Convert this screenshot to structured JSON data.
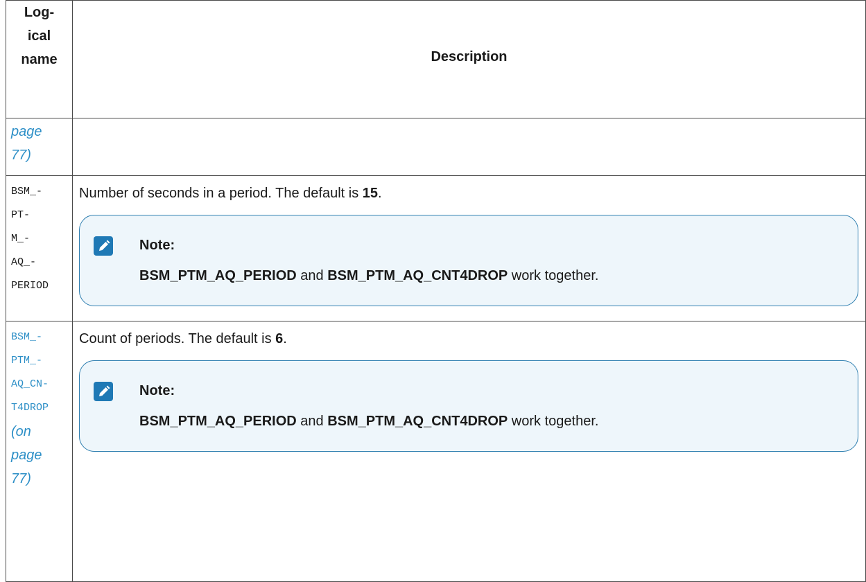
{
  "table": {
    "header": {
      "name_lines": [
        "Log-",
        "ical",
        "name"
      ],
      "description": "Description"
    },
    "rows": [
      {
        "name_link_lines": [
          "page",
          "77)"
        ],
        "description": ""
      },
      {
        "name_lines": [
          "BSM_-",
          "PT-",
          "M_-",
          "AQ_-",
          "PERIOD"
        ],
        "description_prefix": "Number of seconds in a period. The default is ",
        "description_value": "15",
        "description_suffix": ".",
        "note": {
          "title": "Note:",
          "term1": "BSM_PTM_AQ_PERIOD",
          "conj": " and ",
          "term2": "BSM_PTM_AQ_CNT4DROP",
          "rest": " work together."
        }
      },
      {
        "name_lines": [
          "BSM_-",
          "PTM_-",
          "AQ_CN-",
          "T4DROP"
        ],
        "name_link_lines": [
          "(on",
          "page",
          "77)"
        ],
        "description_prefix": "Count of periods. The default is ",
        "description_value": "6",
        "description_suffix": ".",
        "note": {
          "title": "Note:",
          "term1": "BSM_PTM_AQ_PERIOD",
          "conj": " and ",
          "term2": "BSM_PTM_AQ_CNT4DROP",
          "rest": " work together."
        }
      }
    ]
  },
  "colors": {
    "link": "#2d8fc7",
    "note_border": "#2f7fb0",
    "note_background": "#eef6fb",
    "note_icon": "#1f79b5"
  },
  "icons": {
    "note": "pencil-icon"
  }
}
